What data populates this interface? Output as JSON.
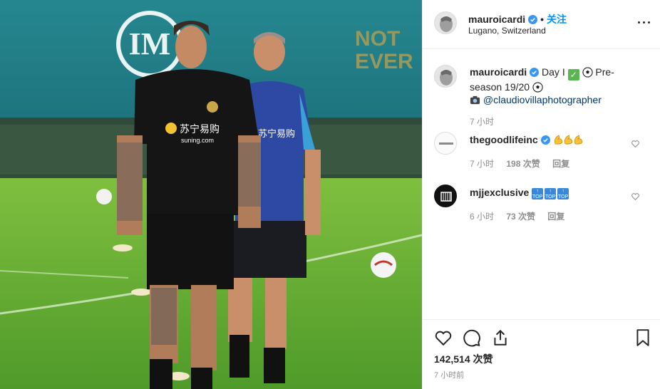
{
  "post": {
    "username": "mauroicardi",
    "separator": "•",
    "follow_label": "关注",
    "location": "Lugano, Switzerland"
  },
  "photo": {
    "banner_text_line1": "NOT",
    "banner_text_line2": "EVER",
    "sponsor_cn": "苏宁易购",
    "sponsor_en": "suning.com"
  },
  "caption": {
    "username": "mauroicardi",
    "text_part1": "Day I",
    "text_part2": "Pre-season 19/20",
    "mention": "@claudiovillaphotographer",
    "time": "7 小时"
  },
  "comments": [
    {
      "username": "thegoodlifeinc",
      "emoji": "muscle-emoji x3",
      "time": "7 小时",
      "likes": "198 次赞",
      "reply": "回复"
    },
    {
      "username": "mjjexclusive",
      "emoji": "top-arrow-emoji x3",
      "badge_text": "TOP",
      "time": "6 小时",
      "likes": "73 次赞",
      "reply": "回复"
    }
  ],
  "footer": {
    "like_count": "142,514 次赞",
    "posted": "7 小时前"
  },
  "colors": {
    "link_blue": "#0095f6",
    "verified_blue": "#3897f0",
    "muted": "#8e8e8e",
    "text": "#262626"
  },
  "icons": [
    "more-options-icon",
    "verified-badge-icon",
    "heart-icon",
    "comment-icon",
    "share-icon",
    "bookmark-icon",
    "camera-emoji",
    "soccer-ball-emoji",
    "check-mark-emoji"
  ]
}
